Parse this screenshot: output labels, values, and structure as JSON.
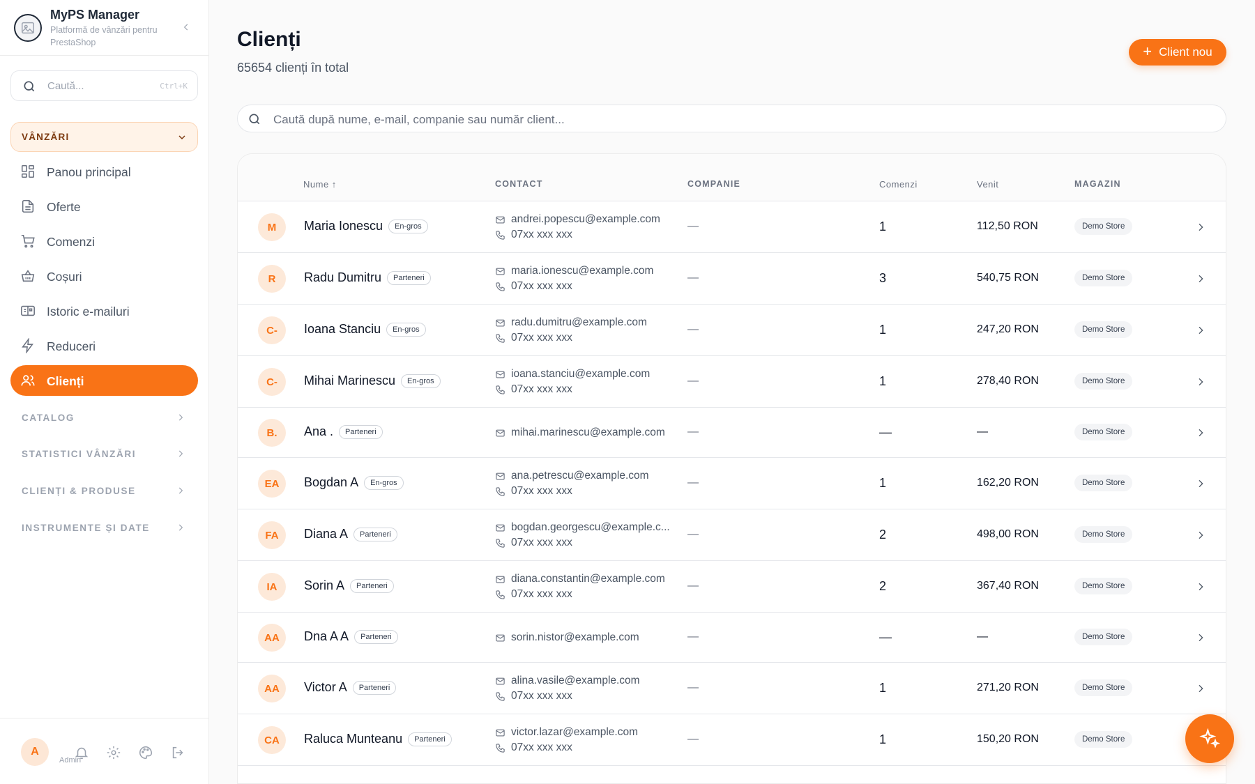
{
  "app": {
    "name": "MyPS Manager",
    "subtitle": "Platformă de vânzări pentru PrestaShop"
  },
  "sidebar": {
    "search_placeholder": "Caută...",
    "search_shortcut": "Ctrl+K",
    "open_section": "VÂNZĂRI",
    "items": [
      {
        "label": "Panou principal",
        "icon": "dashboard-icon"
      },
      {
        "label": "Oferte",
        "icon": "document-icon"
      },
      {
        "label": "Comenzi",
        "icon": "cart-icon"
      },
      {
        "label": "Coșuri",
        "icon": "basket-icon"
      },
      {
        "label": "Istoric e-mailuri",
        "icon": "email-history-icon"
      },
      {
        "label": "Reduceri",
        "icon": "lightning-icon"
      },
      {
        "label": "Clienți",
        "icon": "users-icon",
        "active": true
      }
    ],
    "sections": [
      "CATALOG",
      "STATISTICI VÂNZĂRI",
      "CLIENȚI & PRODUSE",
      "INSTRUMENTE ȘI DATE"
    ],
    "footer": {
      "avatar_initial": "A",
      "admin_label": "Admin"
    }
  },
  "header": {
    "title": "Clienți",
    "subtitle": "65654 clienți în total",
    "new_button": "Client nou"
  },
  "search": {
    "placeholder": "Caută după nume, e-mail, companie sau număr client..."
  },
  "table": {
    "columns": {
      "name": "Nume ↑",
      "contact": "CONTACT",
      "company": "COMPANIE",
      "orders": "Comenzi",
      "revenue": "Venit",
      "store": "MAGAZIN"
    },
    "rows": [
      {
        "initials": "M",
        "name": "Maria Ionescu",
        "tag": "En-gros",
        "email": "andrei.popescu@example.com",
        "phone": "07xx xxx xxx",
        "company": "—",
        "orders": "1",
        "revenue": "112,50 RON",
        "store": "Demo Store"
      },
      {
        "initials": "R",
        "name": "Radu Dumitru",
        "tag": "Parteneri",
        "email": "maria.ionescu@example.com",
        "phone": "07xx xxx xxx",
        "company": "—",
        "orders": "3",
        "revenue": "540,75 RON",
        "store": "Demo Store"
      },
      {
        "initials": "C-",
        "name": "Ioana Stanciu",
        "tag": "En-gros",
        "email": "radu.dumitru@example.com",
        "phone": "07xx xxx xxx",
        "company": "—",
        "orders": "1",
        "revenue": "247,20 RON",
        "store": "Demo Store"
      },
      {
        "initials": "C-",
        "name": "Mihai Marinescu",
        "tag": "En-gros",
        "email": "ioana.stanciu@example.com",
        "phone": "07xx xxx xxx",
        "company": "—",
        "orders": "1",
        "revenue": "278,40 RON",
        "store": "Demo Store"
      },
      {
        "initials": "B.",
        "name": "Ana .",
        "tag": "Parteneri",
        "email": "mihai.marinescu@example.com",
        "phone": "",
        "company": "—",
        "orders": "—",
        "revenue": "—",
        "store": "Demo Store"
      },
      {
        "initials": "EA",
        "name": "Bogdan A",
        "tag": "En-gros",
        "email": "ana.petrescu@example.com",
        "phone": "07xx xxx xxx",
        "company": "—",
        "orders": "1",
        "revenue": "162,20 RON",
        "store": "Demo Store"
      },
      {
        "initials": "FA",
        "name": "Diana A",
        "tag": "Parteneri",
        "email": "bogdan.georgescu@example.c...",
        "phone": "07xx xxx xxx",
        "company": "—",
        "orders": "2",
        "revenue": "498,00 RON",
        "store": "Demo Store"
      },
      {
        "initials": "IA",
        "name": "Sorin A",
        "tag": "Parteneri",
        "email": "diana.constantin@example.com",
        "phone": "07xx xxx xxx",
        "company": "—",
        "orders": "2",
        "revenue": "367,40 RON",
        "store": "Demo Store"
      },
      {
        "initials": "AA",
        "name": "Dna A A",
        "tag": "Parteneri",
        "email": "sorin.nistor@example.com",
        "phone": "",
        "company": "—",
        "orders": "—",
        "revenue": "—",
        "store": "Demo Store"
      },
      {
        "initials": "AA",
        "name": "Victor A",
        "tag": "Parteneri",
        "email": "alina.vasile@example.com",
        "phone": "07xx xxx xxx",
        "company": "—",
        "orders": "1",
        "revenue": "271,20 RON",
        "store": "Demo Store"
      },
      {
        "initials": "CA",
        "name": "Raluca Munteanu",
        "tag": "Parteneri",
        "email": "victor.lazar@example.com",
        "phone": "07xx xxx xxx",
        "company": "—",
        "orders": "1",
        "revenue": "150,20 RON",
        "store": "Demo Store"
      }
    ]
  },
  "colors": {
    "accent": "#f97316",
    "accent_soft": "#fde9d9",
    "text": "#111827",
    "muted": "#6b7280"
  }
}
